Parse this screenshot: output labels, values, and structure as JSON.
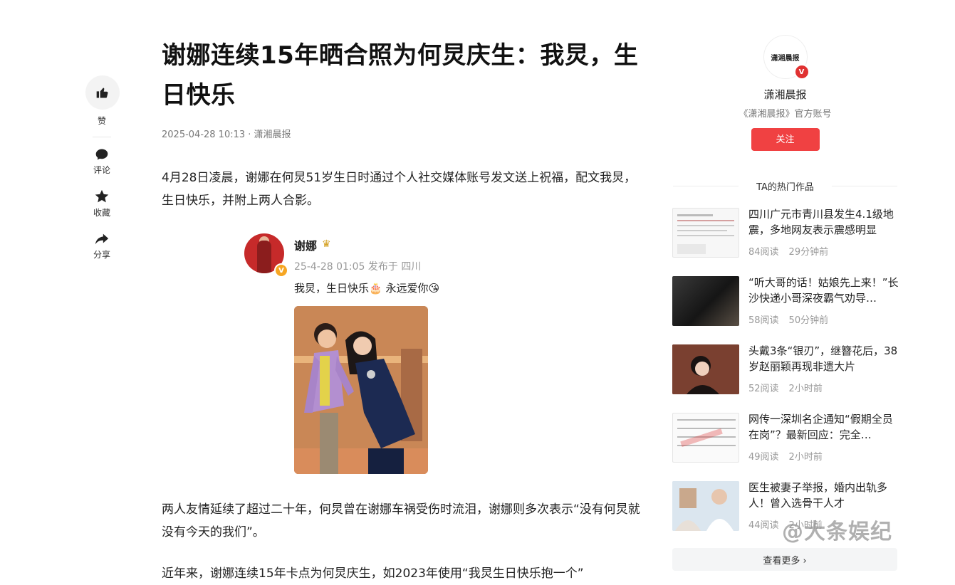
{
  "article": {
    "title": "谢娜连续15年晒合照为何炅庆生：我炅，生日快乐",
    "meta": "2025-04-28 10:13 · 潇湘晨报",
    "paragraphs": [
      "4月28日凌晨，谢娜在何炅51岁生日时通过个人社交媒体账号发文送上祝福，配文我炅，生日快乐，并附上两人合影。",
      "两人友情延续了超过二十年，何炅曾在谢娜车祸受伤时流泪，谢娜则多次表示“没有何炅就没有今天的我们”。",
      "近年来，谢娜连续15年卡点为何炅庆生，如2023年使用“我炅生日快乐抱一个”"
    ]
  },
  "rail": {
    "like_label": "赞",
    "comment_label": "评论",
    "collect_label": "收藏",
    "share_label": "分享"
  },
  "weibo": {
    "name": "谢娜",
    "badge": "V",
    "time": "25-4-28 01:05 发布于 四川",
    "text": "我炅，生日快乐🎂 永远爱你😘"
  },
  "author": {
    "logo_text": "潇湘晨报",
    "badge": "V",
    "name": "潇湘晨报",
    "desc": "《潇湘晨报》官方账号",
    "follow_label": "关注"
  },
  "hot": {
    "title": "TA的热门作品",
    "items": [
      {
        "text": "四川广元市青川县发生4.1级地震，多地网友表示震感明显",
        "reads": "84阅读",
        "time": "29分钟前"
      },
      {
        "text": "“听大哥的话！姑娘先上来！”长沙快递小哥深夜霸气劝导…",
        "reads": "58阅读",
        "time": "50分钟前"
      },
      {
        "text": "头戴3条“银刃”，继簪花后，38岁赵丽颖再现非遗大片",
        "reads": "52阅读",
        "time": "2小时前"
      },
      {
        "text": "网传一深圳名企通知“假期全员在岗”？最新回应：完全…",
        "reads": "49阅读",
        "time": "2小时前"
      },
      {
        "text": "医生被妻子举报，婚内出轨多人！曾入选骨干人才",
        "reads": "44阅读",
        "time": "2小时前"
      }
    ],
    "more_label": "查看更多 ›"
  },
  "watermark": "@大条娱纪"
}
